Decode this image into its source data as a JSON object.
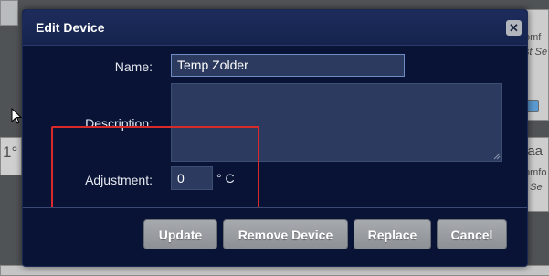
{
  "dialog": {
    "title": "Edit Device",
    "close_icon": "close-icon",
    "name_label": "Name:",
    "name_value": "Temp Zolder",
    "description_label": "Description:",
    "description_value": "",
    "adjustment_label": "Adjustment:",
    "adjustment_value": "0",
    "adjustment_unit": "° C",
    "buttons": {
      "update": "Update",
      "remove": "Remove Device",
      "replace": "Replace",
      "cancel": "Cancel"
    }
  },
  "background": {
    "left_temp": "1°",
    "right_title": "laa",
    "right_line1": "omf",
    "right_line2": "st Se",
    "right_line3": "omfo",
    "right_line4": "t Se"
  },
  "colors": {
    "dialog_bg": "#081336",
    "highlight": "#d92a2a",
    "button_bg": "#9a9da2"
  }
}
